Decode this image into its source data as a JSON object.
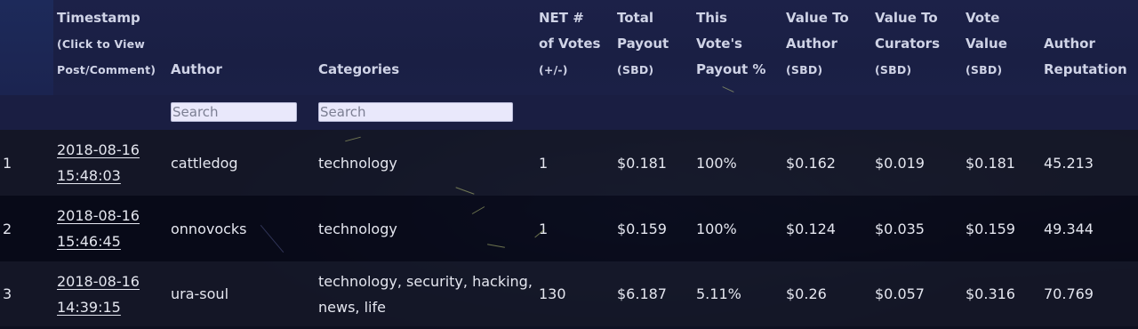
{
  "table": {
    "headers": {
      "timestamp_title": "Timestamp",
      "timestamp_hint_1": "(Click to View",
      "timestamp_hint_2": "Post/Comment)",
      "author": "Author",
      "categories": "Categories",
      "votes_1": "NET #",
      "votes_2": "of Votes",
      "votes_3": "(+/-)",
      "payout_1": "Total",
      "payout_2": "Payout",
      "payout_3": "(SBD)",
      "pct_1": "This",
      "pct_2": "Vote's",
      "pct_3": "Payout %",
      "vta_1": "Value To",
      "vta_2": "Author",
      "vta_3": "(SBD)",
      "vtc_1": "Value To",
      "vtc_2": "Curators",
      "vtc_3": "(SBD)",
      "vv_1": "Vote",
      "vv_2": "Value",
      "vv_3": "(SBD)",
      "rep_1": "Author",
      "rep_2": "Reputation"
    },
    "filters": {
      "author_placeholder": "Search",
      "categories_placeholder": "Search"
    },
    "rows": [
      {
        "index": "1",
        "date": "2018-08-16",
        "time": "15:48:03",
        "author": "cattledog",
        "categories_1": "technology",
        "categories_2": "",
        "votes": "1",
        "payout": "$0.181",
        "pct": "100%",
        "vta": "$0.162",
        "vtc": "$0.019",
        "vv": "$0.181",
        "rep": "45.213"
      },
      {
        "index": "2",
        "date": "2018-08-16",
        "time": "15:46:45",
        "author": "onnovocks",
        "categories_1": "technology",
        "categories_2": "",
        "votes": "1",
        "payout": "$0.159",
        "pct": "100%",
        "vta": "$0.124",
        "vtc": "$0.035",
        "vv": "$0.159",
        "rep": "49.344"
      },
      {
        "index": "3",
        "date": "2018-08-16",
        "time": "14:39:15",
        "author": "ura-soul",
        "categories_1": "technology, security, hacking,",
        "categories_2": "news, life",
        "votes": "130",
        "payout": "$6.187",
        "pct": "5.11%",
        "vta": "$0.26",
        "vtc": "$0.057",
        "vv": "$0.316",
        "rep": "70.769"
      }
    ]
  }
}
